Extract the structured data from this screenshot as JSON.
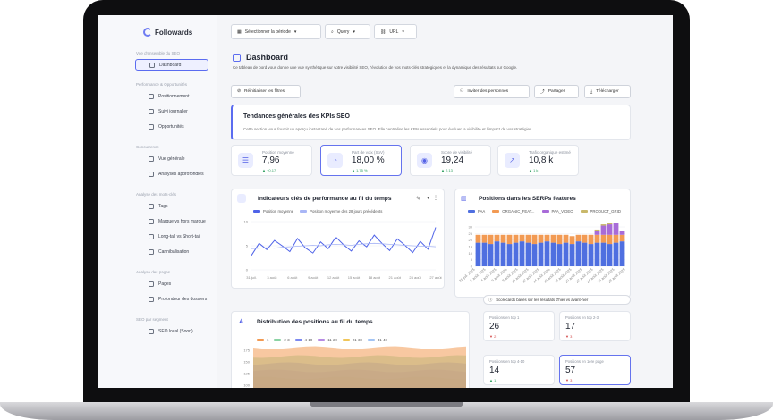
{
  "app": {
    "logo": "Followards"
  },
  "sidebar": {
    "sections": [
      {
        "title": "Vue d'ensemble du SEO",
        "items": [
          {
            "label": "Dashboard",
            "icon": "grid-icon",
            "active": true
          }
        ]
      },
      {
        "title": "Performance & Opportunités",
        "items": [
          {
            "label": "Positionnement",
            "icon": "chart-icon"
          },
          {
            "label": "Suivi journalier",
            "icon": "trend-icon"
          },
          {
            "label": "Opportunités",
            "icon": "bulb-icon"
          }
        ]
      },
      {
        "title": "Concurrence",
        "items": [
          {
            "label": "Vue générale",
            "icon": "target-icon"
          },
          {
            "label": "Analyses approfondies",
            "icon": "users-icon"
          }
        ]
      },
      {
        "title": "Analyse des mots-clés",
        "items": [
          {
            "label": "Tags",
            "icon": "tag-icon"
          },
          {
            "label": "Marque vs hors marque",
            "icon": "chat-icon"
          },
          {
            "label": "Long-tail vs Short-tail",
            "icon": "chart-icon"
          },
          {
            "label": "Cannibalisation",
            "icon": "split-icon"
          }
        ]
      },
      {
        "title": "Analyse des pages",
        "items": [
          {
            "label": "Pages",
            "icon": "link-icon"
          },
          {
            "label": "Profondeur des dossiers",
            "icon": "folder-icon"
          }
        ]
      },
      {
        "title": "SEO par segment",
        "items": [
          {
            "label": "SEO local (Soon)",
            "icon": "pin-icon"
          }
        ]
      }
    ]
  },
  "topbar": {
    "period": "Sélectionner la période",
    "query": "Query",
    "url": "URL"
  },
  "header": {
    "title": "Dashboard",
    "description": "Ce tableau de bord vous donne une vue synthétique sur votre visibilité SEO, l'évolution de vos mots-clés stratégiques et la dynamique des résultats sur Google."
  },
  "actions": {
    "reset": "Réinitialiser les filtres",
    "invite": "Inviter des personnes",
    "share": "Partager",
    "download": "Télécharger"
  },
  "kpi_section": {
    "title": "Tendances générales des KPIs SEO",
    "subtitle": "Cette section vous fournit un aperçu instantané de vos performances SEO. Elle centralise les KPIs essentiels pour évaluer la visibilité et l'impact de vos stratégies."
  },
  "kpis": [
    {
      "label": "Position moyenne",
      "value": "7,96",
      "delta": "▲ +0,17",
      "icon": "list-icon"
    },
    {
      "label": "Part de voix (SoV)",
      "value": "18,00 %",
      "delta": "▲ 1,75 %",
      "icon": "pie-icon",
      "selected": true
    },
    {
      "label": "Score de visibilité",
      "value": "19,24",
      "delta": "▲ 2,13",
      "icon": "eye-icon"
    },
    {
      "label": "Trafic organique estimé",
      "value": "10,8 k",
      "delta": "▲ 1 k",
      "icon": "trend-icon"
    }
  ],
  "kpi_chart": {
    "title": "Indicateurs clés de performance au fil du temps",
    "chart_data": {
      "type": "line",
      "x": [
        "31 juil.",
        "3 août",
        "6 août",
        "9 août",
        "12 août",
        "15 août",
        "18 août",
        "21 août",
        "24 août",
        "27 août"
      ],
      "series": [
        {
          "name": "Position moyenne",
          "values": [
            3.0,
            5.5,
            4.2,
            6.1,
            5.0,
            3.8,
            6.5,
            4.6,
            3.5,
            5.8,
            4.4,
            6.8,
            5.2,
            3.9,
            6.0,
            4.8,
            7.2,
            5.5,
            4.0,
            6.4,
            5.1,
            3.6,
            5.9,
            4.3,
            8.8
          ]
        },
        {
          "name": "Position moyenne des 28 jours précédents",
          "values": [
            4.4,
            4.5,
            4.6,
            4.5,
            4.7,
            4.8,
            4.9,
            5.0,
            5.1,
            5.0,
            5.2,
            5.3,
            5.2,
            5.1,
            5.3,
            5.4,
            5.5,
            5.4,
            5.3,
            5.2,
            5.1,
            5.0,
            4.9,
            4.9,
            4.8
          ]
        }
      ],
      "ylim": [
        0,
        10
      ],
      "yticks": [
        0,
        5,
        10
      ],
      "colors": [
        "#4f63e8",
        "#a9b6f6"
      ]
    }
  },
  "serp_chart": {
    "title": "Positions dans les SERPs features",
    "chart_data": {
      "type": "bar",
      "series": [
        {
          "name": "PAA",
          "color": "#4f6fe0",
          "values": [
            18,
            18,
            17,
            19,
            18,
            17,
            18,
            19,
            18,
            17,
            18,
            19,
            18,
            17,
            18,
            17,
            19,
            18,
            17,
            18,
            18,
            17,
            18,
            19
          ]
        },
        {
          "name": "ORGANIC_FEAT...",
          "color": "#f29a53",
          "values": [
            6,
            6,
            7,
            5,
            6,
            7,
            6,
            5,
            6,
            7,
            6,
            5,
            6,
            7,
            6,
            6,
            5,
            6,
            7,
            6,
            6,
            7,
            6,
            5
          ]
        },
        {
          "name": "PAA_VIDEO",
          "color": "#a86bd8",
          "values": [
            0,
            0,
            0,
            0,
            0,
            0,
            0,
            0,
            0,
            0,
            0,
            0,
            0,
            0,
            0,
            0,
            0,
            0,
            0,
            3,
            7,
            8,
            9,
            3
          ]
        },
        {
          "name": "PRODUCT_GRID",
          "color": "#c9b86a",
          "values": [
            0,
            0,
            0,
            0,
            0,
            0,
            0,
            0,
            0,
            0,
            0,
            0,
            0,
            0,
            0,
            0,
            0,
            0,
            0,
            1,
            1,
            1,
            1,
            0
          ]
        }
      ],
      "ylim": [
        0,
        30
      ],
      "yticks": [
        0,
        5,
        10,
        15,
        20,
        25,
        30
      ],
      "xticks": [
        "31 juil. 2025",
        "2 août 2025",
        "4 août 2025",
        "6 août 2025",
        "8 août 2025",
        "10 août 2025",
        "12 août 2025",
        "14 août 2025",
        "16 août 2025",
        "18 août 2025",
        "20 août 2025",
        "22 août 2025",
        "24 août 2025",
        "26 août 2025",
        "28 août 2025"
      ]
    }
  },
  "scorecards": {
    "note": "Scorecards basés sur les résultats d'hier vs avant-hier",
    "items": [
      {
        "label": "Positions en top 1",
        "value": "26",
        "delta": "▼ 2",
        "up": false
      },
      {
        "label": "Positions en top 2-3",
        "value": "17",
        "delta": "▼ 3",
        "up": false
      },
      {
        "label": "Positions en top 4-10",
        "value": "14",
        "delta": "▲ 1",
        "up": true
      },
      {
        "label": "Positions en 1ère page",
        "value": "57",
        "delta": "▼ 3",
        "up": false,
        "selected": true
      }
    ]
  },
  "distribution_chart": {
    "title": "Distribution des positions au fil du temps",
    "chart_data": {
      "type": "area",
      "legend": [
        "1",
        "2-3",
        "4-10",
        "11-20",
        "21-30",
        "31-40"
      ],
      "colors": [
        "#f29a53",
        "#8bd3a4",
        "#7d8af0",
        "#b68be3",
        "#f0c65a",
        "#a3c4f3"
      ],
      "yticks": [
        100,
        125,
        150,
        175
      ]
    }
  }
}
